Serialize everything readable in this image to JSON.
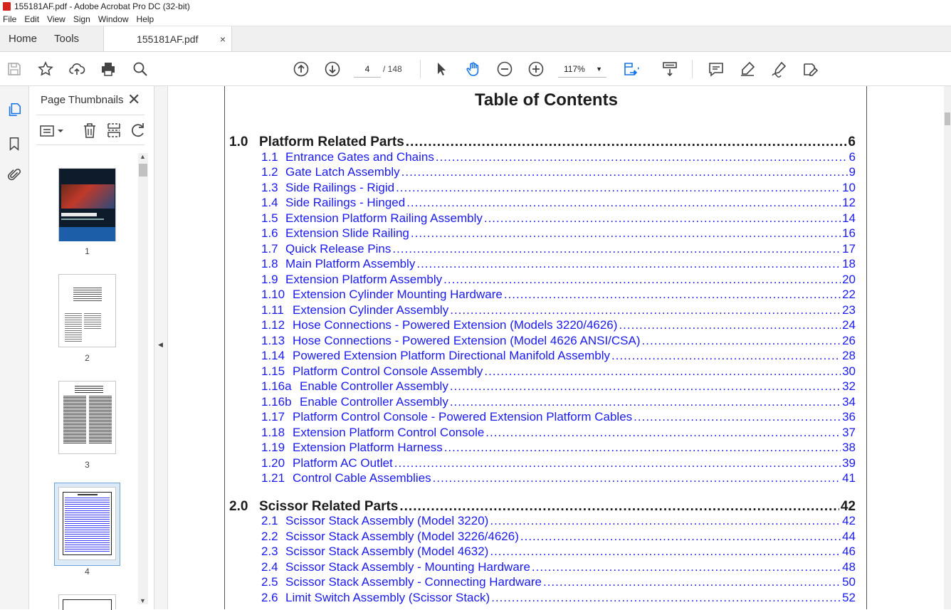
{
  "window": {
    "title": "155181AF.pdf - Adobe Acrobat Pro DC (32-bit)"
  },
  "menu": [
    "File",
    "Edit",
    "View",
    "Sign",
    "Window",
    "Help"
  ],
  "tabs": {
    "home": "Home",
    "tools": "Tools",
    "document": "155181AF.pdf",
    "close": "×"
  },
  "toolbar": {
    "page_current": "4",
    "page_total": "/   148",
    "zoom": "117%"
  },
  "thumbnails": {
    "title": "Page Thumbnails",
    "close": "✕",
    "pages": [
      "1",
      "2",
      "3",
      "4"
    ]
  },
  "document": {
    "heading": "Table of Contents",
    "sections": [
      {
        "num": "1.0",
        "title": "Platform Related Parts",
        "page": "6",
        "entries": [
          {
            "num": "1.1",
            "title": "Entrance Gates and Chains",
            "page": "6"
          },
          {
            "num": "1.2",
            "title": "Gate Latch Assembly",
            "page": "9"
          },
          {
            "num": "1.3",
            "title": "Side Railings - Rigid",
            "page": "10"
          },
          {
            "num": "1.4",
            "title": "Side Railings - Hinged",
            "page": "12"
          },
          {
            "num": "1.5",
            "title": "Extension Platform Railing Assembly",
            "page": "14"
          },
          {
            "num": "1.6",
            "title": "Extension Slide Railing",
            "page": "16"
          },
          {
            "num": "1.7",
            "title": "Quick Release Pins",
            "page": "17"
          },
          {
            "num": "1.8",
            "title": "Main Platform Assembly",
            "page": "18"
          },
          {
            "num": "1.9",
            "title": "Extension Platform Assembly",
            "page": "20"
          },
          {
            "num": "1.10",
            "title": "Extension Cylinder Mounting Hardware",
            "page": "22"
          },
          {
            "num": "1.11",
            "title": "Extension Cylinder Assembly",
            "page": "23"
          },
          {
            "num": "1.12",
            "title": "Hose Connections - Powered Extension (Models 3220/4626)",
            "page": "24"
          },
          {
            "num": "1.13",
            "title": "Hose Connections - Powered Extension (Model 4626 ANSI/CSA)",
            "page": "26"
          },
          {
            "num": "1.14",
            "title": "Powered Extension Platform Directional Manifold Assembly",
            "page": "28"
          },
          {
            "num": "1.15",
            "title": "Platform Control Console Assembly",
            "page": "30"
          },
          {
            "num": "1.16a",
            "title": "Enable Controller Assembly",
            "page": "32"
          },
          {
            "num": "1.16b",
            "title": "Enable Controller Assembly",
            "page": "34"
          },
          {
            "num": "1.17",
            "title": "Platform Control Console - Powered Extension Platform Cables",
            "page": "36"
          },
          {
            "num": "1.18",
            "title": "Extension Platform Control Console",
            "page": "37"
          },
          {
            "num": "1.19",
            "title": "Extension Platform Harness",
            "page": "38"
          },
          {
            "num": "1.20",
            "title": "Platform AC Outlet",
            "page": "39"
          },
          {
            "num": "1.21",
            "title": "Control Cable Assemblies",
            "page": "41"
          }
        ]
      },
      {
        "num": "2.0",
        "title": "Scissor Related Parts",
        "page": "42",
        "entries": [
          {
            "num": "2.1",
            "title": "Scissor Stack Assembly (Model 3220)",
            "page": "42"
          },
          {
            "num": "2.2",
            "title": "Scissor Stack Assembly (Model 3226/4626)",
            "page": "44"
          },
          {
            "num": "2.3",
            "title": "Scissor Stack Assembly (Model 4632)",
            "page": "46"
          },
          {
            "num": "2.4",
            "title": "Scissor Stack Assembly - Mounting Hardware",
            "page": "48"
          },
          {
            "num": "2.5",
            "title": "Scissor Stack Assembly - Connecting Hardware",
            "page": "50"
          },
          {
            "num": "2.6",
            "title": "Limit Switch Assembly (Scissor Stack)",
            "page": "52"
          }
        ]
      }
    ]
  },
  "colors": {
    "link": "#1a1aee",
    "accent_red": "#d4241c",
    "selected_thumb": "#6fa3d8"
  }
}
